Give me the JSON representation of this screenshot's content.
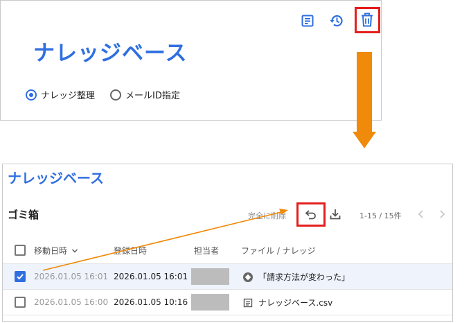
{
  "top_panel": {
    "title": "ナレッジベース",
    "radios": [
      {
        "label": "ナレッジ整理",
        "selected": true
      },
      {
        "label": "メールID指定",
        "selected": false
      }
    ],
    "icons": [
      "note-icon",
      "history-icon",
      "trash-icon"
    ]
  },
  "bottom_panel": {
    "title": "ナレッジベース",
    "section_title": "ゴミ箱",
    "toolbar": {
      "delete_label": "完全に削除",
      "pagination": "1-15 / 15件"
    },
    "columns": [
      "移動日時",
      "登録日時",
      "担当者",
      "ファイル / ナレッジ"
    ],
    "rows": [
      {
        "checked": true,
        "moved_at": "2026.01.05 16:01",
        "registered_at": "2026.01.05 16:01",
        "item": "「請求方法が変わった」",
        "item_icon": "knowledge-icon"
      },
      {
        "checked": false,
        "moved_at": "2026.01.05 16:00",
        "registered_at": "2026.01.05 10:16",
        "item": "ナレッジベース.csv",
        "item_icon": "document-icon"
      }
    ]
  },
  "colors": {
    "accent": "#2f6fe0",
    "highlight": "#e41e1e",
    "arrow": "#f08a0a"
  }
}
